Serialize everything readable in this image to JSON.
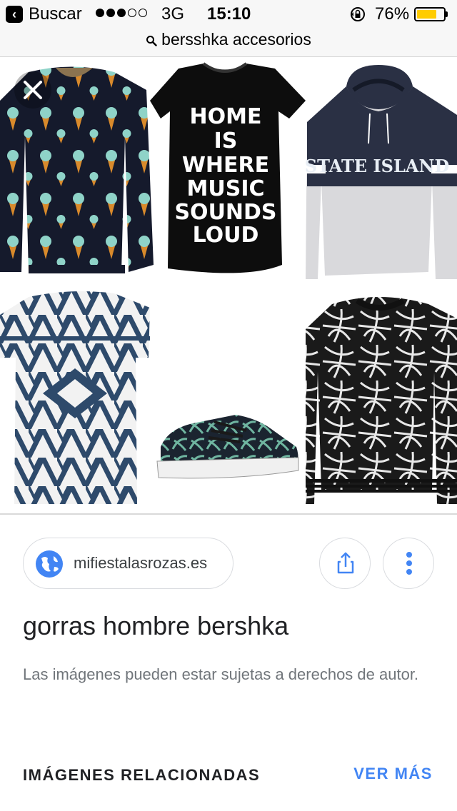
{
  "status_bar": {
    "back_label": "Buscar",
    "carrier": "3G",
    "time": "15:10",
    "battery_percent": "76%",
    "battery_level": 0.76,
    "signal_dots_on": 3,
    "signal_dots_total": 5
  },
  "url_bar": {
    "query": "bersshka accesorios"
  },
  "image_text": {
    "tshirt_print": [
      "HOME",
      "IS",
      "WHERE",
      "MUSIC",
      "SOUNDS",
      "LOUD"
    ],
    "hoodie_print": "STATE ISLAND"
  },
  "details": {
    "site": "mifiestalasrozas.es",
    "title": "gorras hombre bershka",
    "copyright": "Las imágenes pueden estar sujetas a derechos de autor.",
    "related_heading": "IMÁGENES RELACIONADAS",
    "see_more": "VER MÁS"
  },
  "icons": {
    "back": "chevron-left-icon",
    "lock": "rotation-lock-icon",
    "search": "search-icon",
    "close": "close-icon",
    "site": "globe-icon",
    "share": "share-icon",
    "more": "more-vertical-icon"
  },
  "colors": {
    "link_blue": "#4285f4",
    "battery_yellow": "#ffcc00"
  }
}
